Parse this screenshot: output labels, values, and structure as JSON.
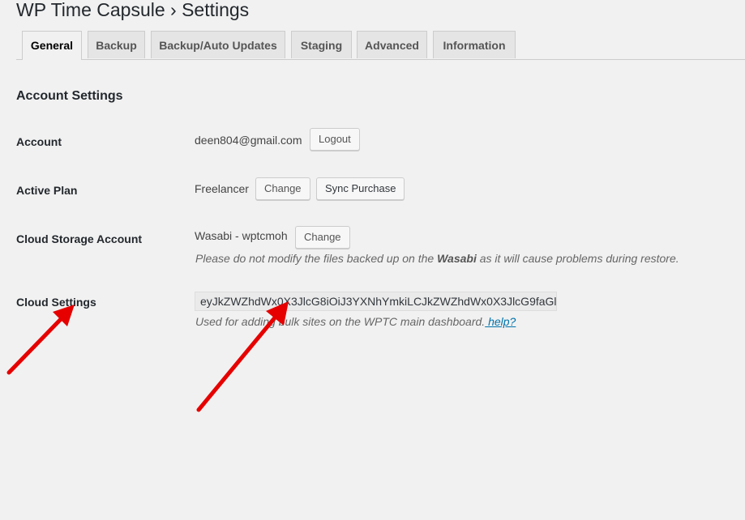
{
  "page": {
    "title": "WP Time Capsule › Settings"
  },
  "tabs": [
    {
      "label": "General",
      "active": true
    },
    {
      "label": "Backup",
      "active": false
    },
    {
      "label": "Backup/Auto Updates",
      "active": false
    },
    {
      "label": "Staging",
      "active": false
    },
    {
      "label": "Advanced",
      "active": false
    },
    {
      "label": "Information",
      "active": false
    }
  ],
  "account_settings": {
    "heading": "Account Settings",
    "account": {
      "label": "Account",
      "value": "deen804@gmail.com",
      "logout_label": "Logout"
    },
    "active_plan": {
      "label": "Active Plan",
      "value": "Freelancer",
      "change_label": "Change",
      "sync_label": "Sync Purchase"
    },
    "cloud_storage": {
      "label": "Cloud Storage Account",
      "value": "Wasabi - wptcmoh",
      "change_label": "Change",
      "note_before": "Please do not modify the files backed up on the ",
      "note_bold": "Wasabi",
      "note_after": " as it will cause problems during restore."
    },
    "cloud_settings": {
      "label": "Cloud Settings",
      "key_value": "eyJkZWZhdWx0X3JlcG8iOiJ3YXNhYmkiLCJkZWZhdWx0X3JlcG9faGl",
      "note_text": "Used for adding bulk sites on the WPTC main dashboard.",
      "help_link": " help?"
    }
  },
  "annotations": {
    "arrow_color": "#e60000"
  }
}
